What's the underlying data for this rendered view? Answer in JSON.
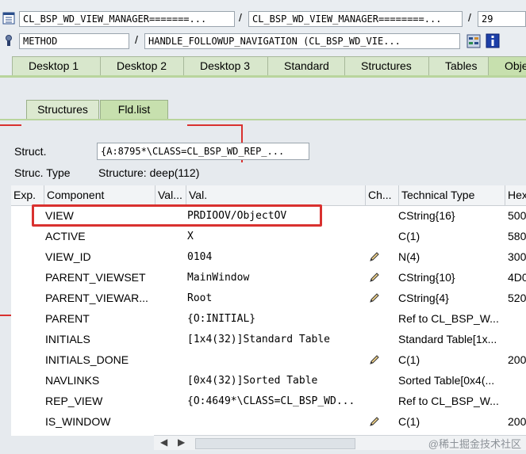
{
  "toolbar": {
    "row1": {
      "class_field": "CL_BSP_WD_VIEW_MANAGER=======...",
      "class_field2": "CL_BSP_WD_VIEW_MANAGER========...",
      "sep1": "/",
      "sep2": "/",
      "number": "29"
    },
    "row2": {
      "type_field": "METHOD",
      "sep": "/",
      "method_field": "HANDLE_FOLLOWUP_NAVIGATION (CL_BSP_WD_VIE..."
    }
  },
  "desktop_tabs": [
    "Desktop 1",
    "Desktop 2",
    "Desktop 3",
    "Standard",
    "Structures",
    "Tables",
    "Obje"
  ],
  "sub_tabs": [
    "Structures",
    "Fld.list"
  ],
  "struct": {
    "label": "Struct.",
    "value": "{A:8795*\\CLASS=CL_BSP_WD_REP_...",
    "type_label": "Struc. Type",
    "type_value": "Structure: deep(112)"
  },
  "grid": {
    "columns": [
      "Exp.",
      "Component",
      "Val...",
      "Val.",
      "Ch...",
      "Technical Type",
      "Hex"
    ],
    "rows": [
      {
        "component": "VIEW",
        "val": "PRDIOOV/ObjectOV",
        "edit": false,
        "type": "CString{16}",
        "hex": "500"
      },
      {
        "component": "ACTIVE",
        "val": "X",
        "edit": false,
        "type": "C(1)",
        "hex": "580"
      },
      {
        "component": "VIEW_ID",
        "val": "0104",
        "edit": true,
        "type": "N(4)",
        "hex": "300"
      },
      {
        "component": "PARENT_VIEWSET",
        "val": "MainWindow",
        "edit": true,
        "type": "CString{10}",
        "hex": "4D0"
      },
      {
        "component": "PARENT_VIEWAR...",
        "val": "Root",
        "edit": true,
        "type": "CString{4}",
        "hex": "520"
      },
      {
        "component": "PARENT",
        "val": "{O:INITIAL}",
        "edit": false,
        "type": "Ref to CL_BSP_W...",
        "hex": ""
      },
      {
        "component": "INITIALS",
        "val": "[1x4(32)]Standard Table",
        "edit": false,
        "type": "Standard Table[1x...",
        "hex": ""
      },
      {
        "component": "INITIALS_DONE",
        "val": "",
        "edit": true,
        "type": "C(1)",
        "hex": "200"
      },
      {
        "component": "NAVLINKS",
        "val": "[0x4(32)]Sorted Table",
        "edit": false,
        "type": "Sorted Table[0x4(...",
        "hex": ""
      },
      {
        "component": "REP_VIEW",
        "val": "{O:4649*\\CLASS=CL_BSP_WD...",
        "edit": false,
        "type": "Ref to CL_BSP_W...",
        "hex": ""
      },
      {
        "component": "IS_WINDOW",
        "val": "",
        "edit": true,
        "type": "C(1)",
        "hex": "200"
      }
    ]
  },
  "watermark": "@稀土掘金技术社区",
  "colors": {
    "highlight": "#d9312f",
    "tab_green": "#d8e7cc",
    "active_tab": "#c7e0ae"
  }
}
